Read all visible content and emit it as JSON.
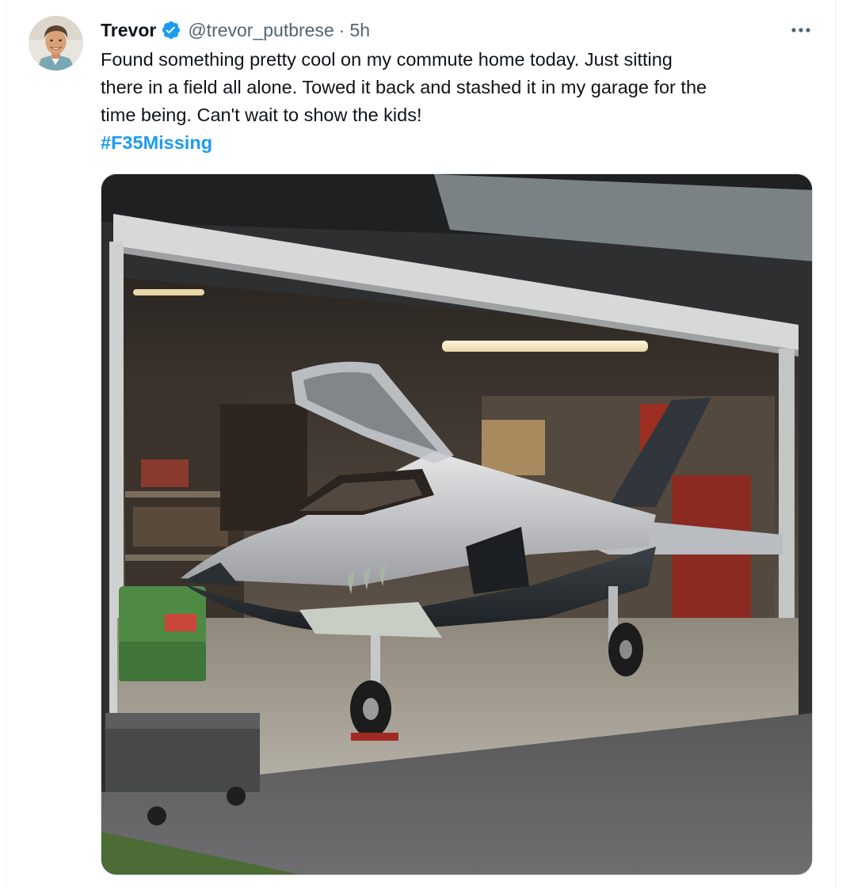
{
  "tweet": {
    "author": {
      "display_name": "Trevor",
      "handle": "@trevor_putbrese",
      "verified": true,
      "avatar_icon": "user-avatar"
    },
    "separator": "·",
    "timestamp": "5h",
    "more_icon": "more-horizontal-icon",
    "text_lines": [
      "Found something pretty cool on my commute home today.  Just sitting",
      "there in a field all alone.  Towed it back and stashed it in my garage for the",
      "time being.  Can't wait to show the kids!"
    ],
    "hashtag": "#F35Missing",
    "media": {
      "kind": "photo"
    }
  },
  "colors": {
    "text": "#0f1419",
    "secondary": "#536471",
    "link": "#1d9bf0",
    "verified_badge": "#1d9bf0",
    "border": "#cfd9de"
  }
}
